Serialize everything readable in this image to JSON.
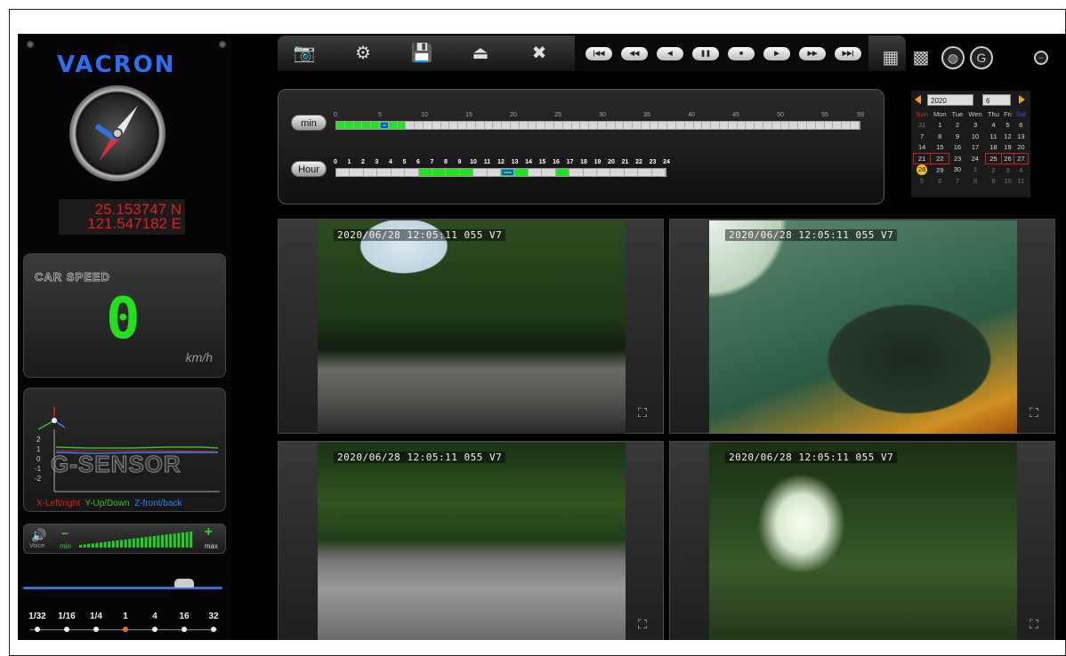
{
  "brand": "VACRON",
  "gps": {
    "lat": "25.153747 N",
    "lon": "121.547182 E"
  },
  "speed": {
    "label": "CAR SPEED",
    "value": "0",
    "unit": "km/h"
  },
  "gsensor": {
    "title": "G-SENSOR",
    "y_ticks": [
      "2",
      "1",
      "0",
      "-1",
      "-2"
    ],
    "legend": {
      "x": "X-Left/right",
      "y": "Y-Up/Down",
      "z": "Z-front/back"
    },
    "colors": {
      "x": "#e02020",
      "y": "#30c030",
      "z": "#3080ff"
    }
  },
  "volume": {
    "label": "Voice",
    "min": "min",
    "max": "max",
    "minus": "−",
    "plus": "+",
    "level": 1.0
  },
  "playback_speeds": [
    "1/32",
    "1/16",
    "1/4",
    "1",
    "4",
    "16",
    "32"
  ],
  "playback_speed_selected": "1",
  "toolbar": {
    "buttons": [
      "camera-icon",
      "settings-icon",
      "save-icon",
      "export-icon",
      "tools-icon"
    ],
    "playback": [
      "|◀◀",
      "◀◀",
      "◀",
      "❚❚",
      "■",
      "▶",
      "▶▶",
      "▶▶|"
    ],
    "right": [
      "quad-view-icon",
      "nine-view-icon",
      "globe-icon",
      "google-earth-icon"
    ]
  },
  "timeline": {
    "min_button": "min",
    "hour_button": "Hour",
    "min_scale": [
      "0",
      "5",
      "10",
      "15",
      "20",
      "25",
      "30",
      "35",
      "40",
      "45",
      "50",
      "55",
      "59"
    ],
    "hour_scale": [
      "0",
      "1",
      "2",
      "3",
      "4",
      "5",
      "6",
      "7",
      "8",
      "9",
      "10",
      "11",
      "12",
      "13",
      "14",
      "15",
      "16",
      "17",
      "18",
      "19",
      "20",
      "21",
      "22",
      "23",
      "24"
    ],
    "min_recorded": [
      0,
      1,
      2,
      3,
      4,
      5,
      6,
      7
    ],
    "min_current": 5,
    "hour_recorded": [
      6,
      7,
      8,
      9,
      12,
      13,
      16
    ],
    "hour_current": 12,
    "accent_color": "#22e022"
  },
  "calendar": {
    "year": "2020",
    "month": "6",
    "weekdays": [
      "Sun",
      "Mon",
      "Tue",
      "Wen",
      "Thu",
      "Fri",
      "Sat"
    ],
    "weeks": [
      [
        "31",
        "1",
        "2",
        "3",
        "4",
        "5",
        "6"
      ],
      [
        "7",
        "8",
        "9",
        "10",
        "11",
        "12",
        "13"
      ],
      [
        "14",
        "15",
        "16",
        "17",
        "18",
        "19",
        "20"
      ],
      [
        "21",
        "22",
        "23",
        "24",
        "25",
        "26",
        "27"
      ],
      [
        "28",
        "29",
        "30",
        "1",
        "2",
        "3",
        "4"
      ],
      [
        "5",
        "6",
        "7",
        "8",
        "9",
        "10",
        "11"
      ]
    ],
    "recorded_days": [
      "21",
      "22",
      "25",
      "26",
      "27"
    ],
    "today": "28"
  },
  "cameras": [
    {
      "osd": "2020/06/28 12:05:11 055 V7"
    },
    {
      "osd": "2020/06/28 12:05:11 055 V7"
    },
    {
      "osd": "2020/06/28 12:05:11 055 V7"
    },
    {
      "osd": "2020/06/28 12:05:11 055 V7"
    }
  ]
}
